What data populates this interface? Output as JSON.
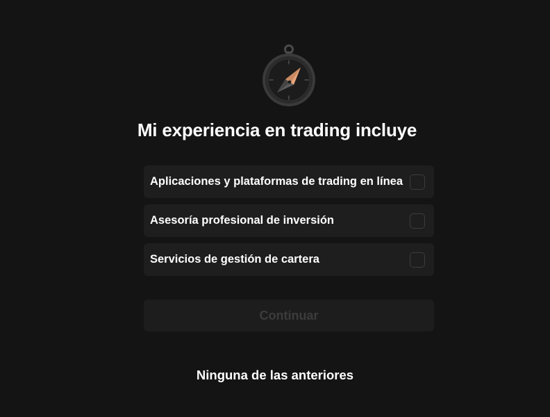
{
  "header": {
    "icon": "compass-icon",
    "title": "Mi experiencia en trading incluye"
  },
  "options": [
    {
      "label": "Aplicaciones y plataformas de trading en línea",
      "checked": false
    },
    {
      "label": "Asesoría profesional de inversión",
      "checked": false
    },
    {
      "label": "Servicios de gestión de cartera",
      "checked": false
    }
  ],
  "actions": {
    "continue_label": "Continuar",
    "continue_enabled": false,
    "none_label": "Ninguna de las anteriores"
  },
  "colors": {
    "background": "#141414",
    "card": "#1e1e1e",
    "compass_needle": "#e8a57a",
    "disabled_text": "#3c3c3c"
  }
}
